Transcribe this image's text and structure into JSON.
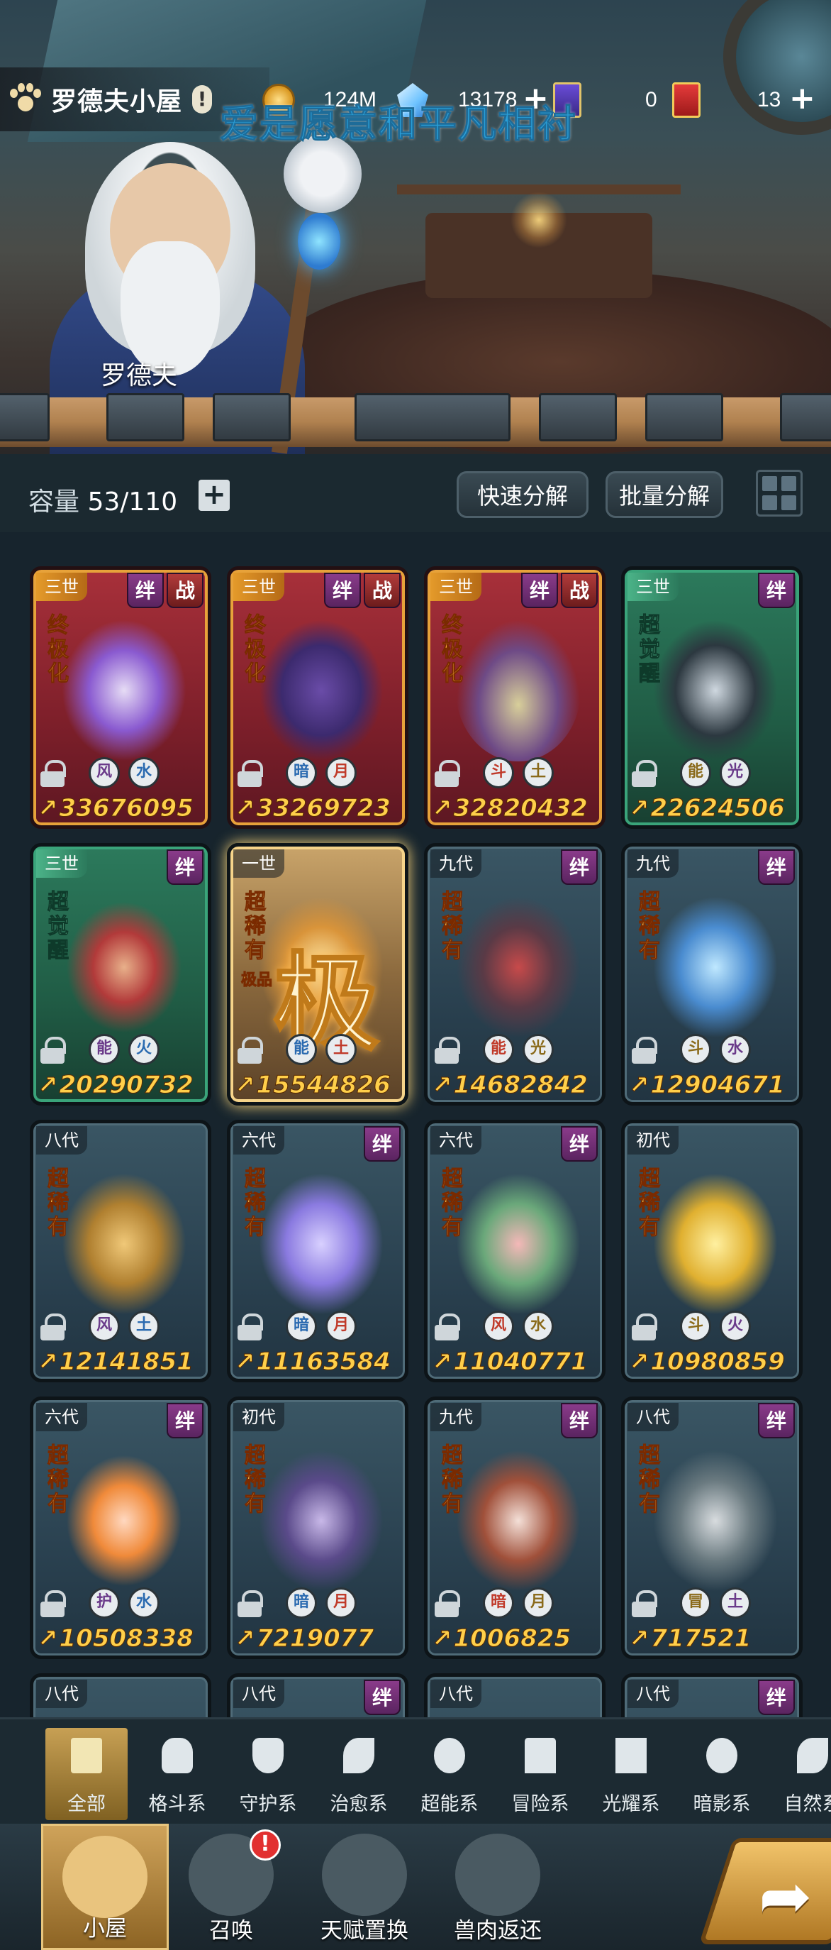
{
  "top": {
    "house_name": "罗德夫小屋",
    "warn_symbol": "!",
    "gold": "124M",
    "crystals": "13178",
    "book_count": "0",
    "card_count": "13",
    "overlay_caption": "爱是愿意和平凡相衬",
    "npc_name": "罗德夫",
    "icons": [
      "paw-icon",
      "gold-coin-icon",
      "crystal-icon",
      "book-icon",
      "red-card-icon"
    ]
  },
  "toolbar": {
    "capacity_label": "容量",
    "capacity_value": "53/110",
    "add_symbol": "+",
    "quick_decompose": "快速分解",
    "batch_decompose": "批量分解"
  },
  "cards": [
    {
      "gen": "三世",
      "tier": "red",
      "rarity": "终极化",
      "badges": [
        "绊",
        "战"
      ],
      "elements": [
        "风",
        "水"
      ],
      "power": "33676095"
    },
    {
      "gen": "三世",
      "tier": "red",
      "rarity": "终极化",
      "badges": [
        "绊",
        "战"
      ],
      "elements": [
        "暗",
        "月"
      ],
      "power": "33269723"
    },
    {
      "gen": "三世",
      "tier": "red",
      "rarity": "终极化",
      "badges": [
        "绊",
        "战"
      ],
      "elements": [
        "斗",
        "土"
      ],
      "power": "32820432"
    },
    {
      "gen": "三世",
      "tier": "green",
      "rarity": "超觉醒",
      "badges": [
        "绊"
      ],
      "elements": [
        "能",
        "光"
      ],
      "power": "22624506"
    },
    {
      "gen": "三世",
      "tier": "green",
      "rarity": "超觉醒",
      "badges": [
        "绊"
      ],
      "elements": [
        "能",
        "火"
      ],
      "power": "20290732"
    },
    {
      "gen": "一世",
      "tier": "gold",
      "rarity": "超稀有",
      "badges": [],
      "elements": [
        "能",
        "土"
      ],
      "power": "15544826",
      "extra": "极品",
      "big_mark": "极"
    },
    {
      "gen": "九代",
      "tier": "blue",
      "rarity": "超稀有",
      "badges": [
        "绊"
      ],
      "elements": [
        "能",
        "光"
      ],
      "power": "14682842"
    },
    {
      "gen": "九代",
      "tier": "blue",
      "rarity": "超稀有",
      "badges": [
        "绊"
      ],
      "elements": [
        "斗",
        "水"
      ],
      "power": "12904671"
    },
    {
      "gen": "八代",
      "tier": "blue",
      "rarity": "超稀有",
      "badges": [],
      "elements": [
        "风",
        "土"
      ],
      "power": "12141851"
    },
    {
      "gen": "六代",
      "tier": "blue",
      "rarity": "超稀有",
      "badges": [
        "绊"
      ],
      "elements": [
        "暗",
        "月"
      ],
      "power": "11163584"
    },
    {
      "gen": "六代",
      "tier": "blue",
      "rarity": "超稀有",
      "badges": [
        "绊"
      ],
      "elements": [
        "风",
        "水"
      ],
      "power": "11040771"
    },
    {
      "gen": "初代",
      "tier": "blue",
      "rarity": "超稀有",
      "badges": [],
      "elements": [
        "斗",
        "火"
      ],
      "power": "10980859"
    },
    {
      "gen": "六代",
      "tier": "blue",
      "rarity": "超稀有",
      "badges": [
        "绊"
      ],
      "elements": [
        "护",
        "水"
      ],
      "power": "10508338"
    },
    {
      "gen": "初代",
      "tier": "blue",
      "rarity": "超稀有",
      "badges": [],
      "elements": [
        "暗",
        "月"
      ],
      "power": "7219077"
    },
    {
      "gen": "九代",
      "tier": "blue",
      "rarity": "超稀有",
      "badges": [
        "绊"
      ],
      "elements": [
        "暗",
        "月"
      ],
      "power": "1006825"
    },
    {
      "gen": "八代",
      "tier": "blue",
      "rarity": "超稀有",
      "badges": [
        "绊"
      ],
      "elements": [
        "冒",
        "土"
      ],
      "power": "717521"
    }
  ],
  "next_row_gens": [
    "八代",
    "八代",
    "八代",
    "八代"
  ],
  "next_row_badges": [
    "",
    "绊",
    "",
    "绊"
  ],
  "categories": [
    {
      "label": "全部",
      "icon": "all-blocks-icon"
    },
    {
      "label": "格斗系",
      "icon": "fist-icon"
    },
    {
      "label": "守护系",
      "icon": "shield-icon"
    },
    {
      "label": "治愈系",
      "icon": "sprout-icon"
    },
    {
      "label": "超能系",
      "icon": "alien-icon"
    },
    {
      "label": "冒险系",
      "icon": "tower-icon"
    },
    {
      "label": "光耀系",
      "icon": "star-icon"
    },
    {
      "label": "暗影系",
      "icon": "eye-icon"
    },
    {
      "label": "自然系",
      "icon": "leaf-icon"
    }
  ],
  "bottom_nav": [
    {
      "label": "小屋",
      "icon": "cat-house-icon"
    },
    {
      "label": "召唤",
      "icon": "egg-icon"
    },
    {
      "label": "天赋置换",
      "icon": "swap-icon"
    },
    {
      "label": "兽肉返还",
      "icon": "meat-icon"
    }
  ],
  "summon_alert": "!"
}
